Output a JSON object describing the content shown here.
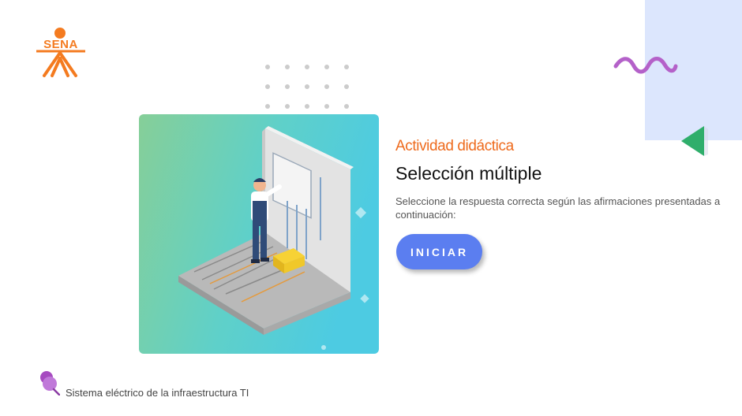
{
  "logo": {
    "text": "SENA",
    "color": "#f47b20"
  },
  "decor": {
    "panel_color": "#dce6fd",
    "wave_color": "#b461c9",
    "triangle_color": "#2fae6b",
    "dots_color": "#cccccc"
  },
  "illustration": {
    "icon": "electrician-illustration"
  },
  "content": {
    "eyebrow": "Actividad didáctica",
    "title": "Selección múltiple",
    "description": "Seleccione la respuesta correcta según las afirmaciones presentadas a continuación:",
    "start_button": "INICIAR",
    "button_color": "#5b7ef0",
    "accent_color": "#ee6b1e"
  },
  "footer": {
    "icon": "pin-icon",
    "text": "Sistema eléctrico de la infraestructura TI"
  }
}
